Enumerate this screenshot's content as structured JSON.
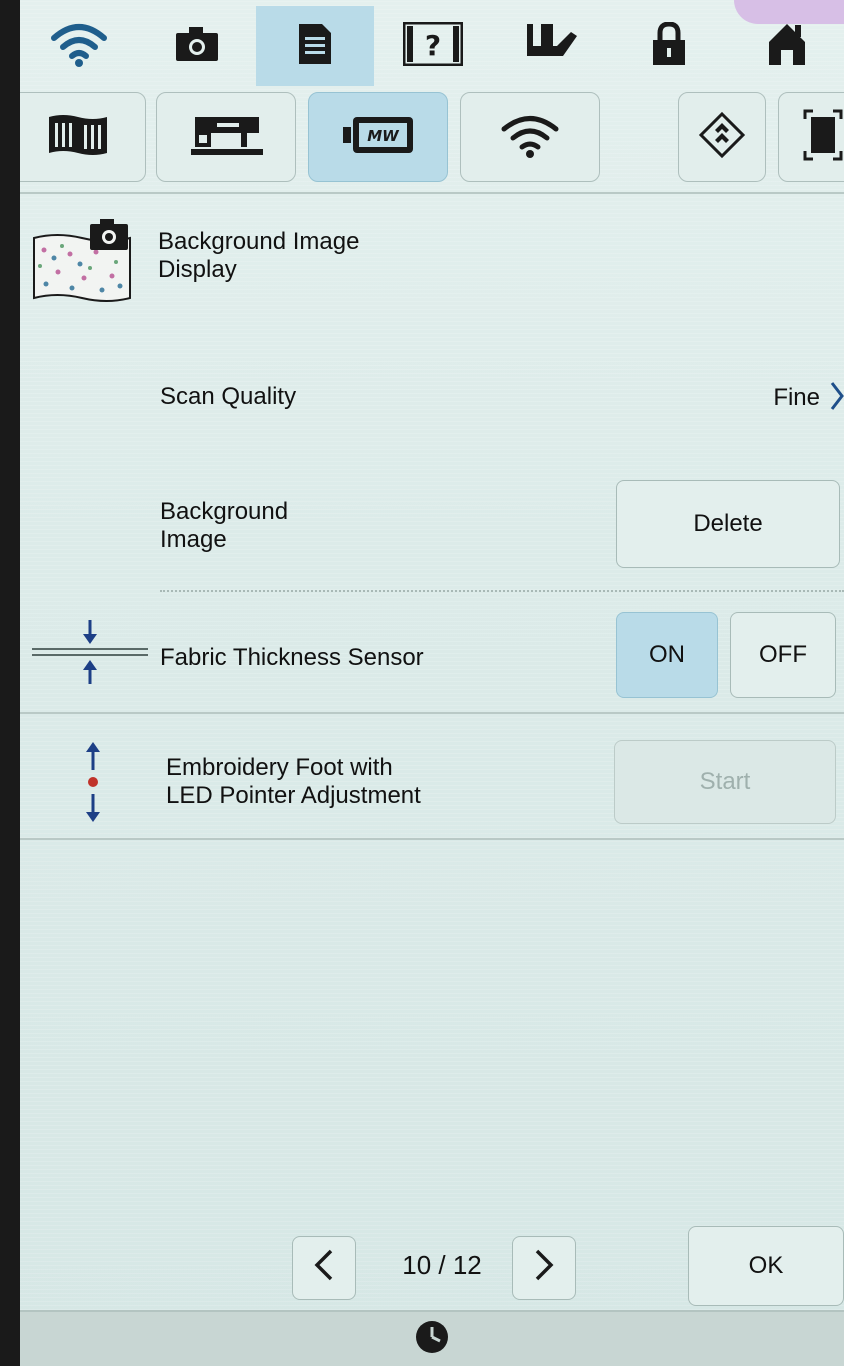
{
  "status_bar": {
    "icons": [
      "wifi-icon",
      "camera-icon",
      "document-icon",
      "help-icon",
      "presser-foot-icon",
      "lock-icon",
      "home-icon"
    ],
    "selected": "document-icon"
  },
  "category_tabs": {
    "icons": [
      "fabric-pattern-icon",
      "sewing-machine-icon",
      "embroidery-frame-icon",
      "wifi-icon",
      "rotate-icon",
      "frame-fit-icon"
    ],
    "selected": "embroidery-frame-icon"
  },
  "settings": {
    "background_image_display": {
      "label": "Background Image\nDisplay"
    },
    "scan_quality": {
      "label": "Scan Quality",
      "value": "Fine"
    },
    "background_image": {
      "label": "Background\nImage",
      "button": "Delete"
    },
    "fabric_thickness": {
      "label": "Fabric Thickness Sensor",
      "on_label": "ON",
      "off_label": "OFF",
      "selected": "ON"
    },
    "led_pointer": {
      "label": "Embroidery Foot with\nLED Pointer Adjustment",
      "button": "Start"
    }
  },
  "pagination": {
    "page": "10 / 12"
  },
  "footer": {
    "ok_label": "OK"
  },
  "colors": {
    "selected_bg": "#b9dbe8",
    "screen_bg": "#e4f0ee",
    "icon_dark": "#1a1a1a",
    "wifi_blue": "#1f5e8c",
    "arrow_blue": "#1d3f86",
    "led_red": "#c0332a"
  }
}
